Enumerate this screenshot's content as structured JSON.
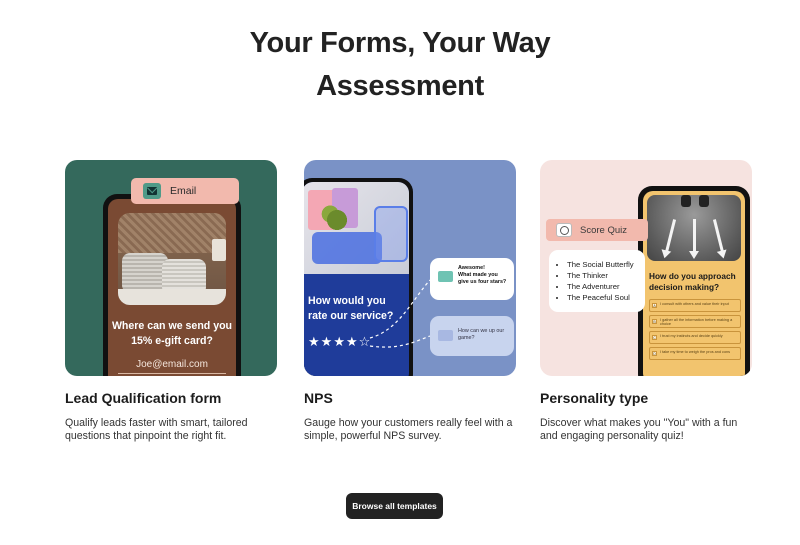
{
  "header": {
    "title_line1": "Your Forms, Your Way",
    "title_line2": "Assessment"
  },
  "cards": [
    {
      "title": "Lead Qualification form",
      "description": "Qualify leads faster with smart, tailored questions that pinpoint the right fit.",
      "bg_color": "#34695c",
      "preview": {
        "tag_label": "Email",
        "tag_icon": "envelope-icon",
        "question": "Where can we send you 15% e-gift card?",
        "input_value": "Joe@email.com"
      }
    },
    {
      "title": "NPS",
      "description": "Gauge how your customers really feel with a simple, powerful NPS survey.",
      "bg_color": "#7a92c6",
      "preview": {
        "question": "How would you rate our service?",
        "stars_filled": 4,
        "stars_total": 5,
        "bubble1_line1": "Awesome!",
        "bubble1_line2": "What made you give us four stars?",
        "bubble2_text": "How can we up our game?"
      }
    },
    {
      "title": "Personality type",
      "description": "Discover what makes you \"You\" with a fun and engaging personality quiz!",
      "bg_color": "#f6e3e0",
      "preview": {
        "tag_label": "Score Quiz",
        "tag_icon": "score-dial-icon",
        "list": [
          "The Social Butterfly",
          "The Thinker",
          "The Adventurer",
          "The Peaceful Soul"
        ],
        "question": "How do you approach decision making?",
        "options": [
          {
            "key": "A",
            "text": "I consult with others and value their input"
          },
          {
            "key": "B",
            "text": "I gather all the information before making a choice"
          },
          {
            "key": "C",
            "text": "I trust my instincts and decide quickly"
          },
          {
            "key": "D",
            "text": "I take my time to weigh the pros and cons"
          }
        ]
      }
    }
  ],
  "cta": {
    "label": "Browse all templates"
  }
}
